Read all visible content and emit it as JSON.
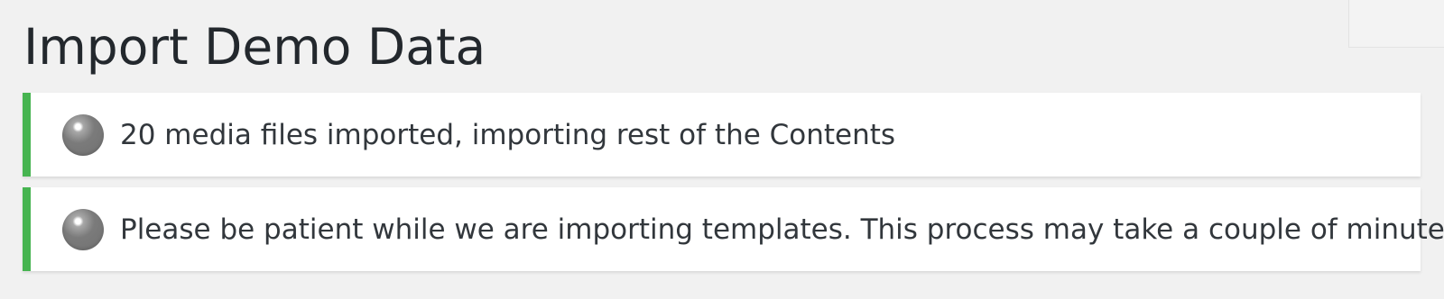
{
  "page": {
    "title": "Import Demo Data"
  },
  "notices": [
    {
      "icon": "spinner-icon",
      "message": "20 media files imported, importing rest of the Contents",
      "accent": "#46b450"
    },
    {
      "icon": "spinner-icon",
      "message": "Please be patient while we are importing templates. This process may take a couple of minutes.",
      "accent": "#46b450"
    }
  ]
}
